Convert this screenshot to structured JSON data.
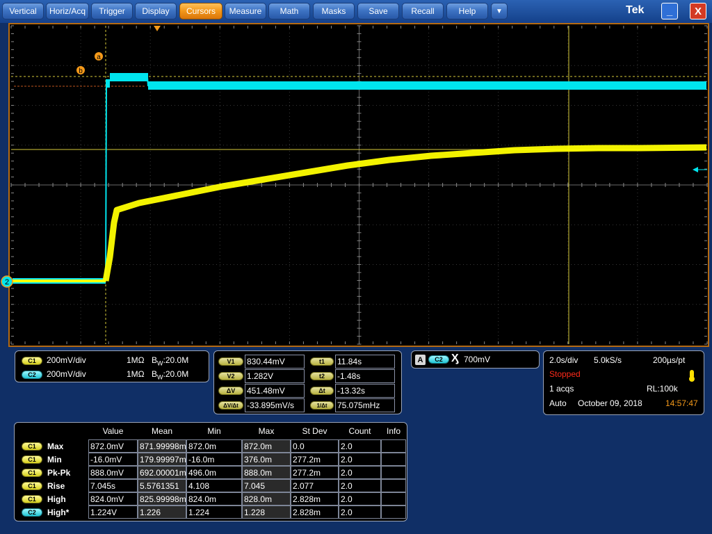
{
  "menu": {
    "items": [
      {
        "label": "Vertical"
      },
      {
        "label": "Horiz/Acq"
      },
      {
        "label": "Trigger"
      },
      {
        "label": "Display"
      },
      {
        "label": "Cursors",
        "active": true
      },
      {
        "label": "Measure"
      },
      {
        "label": "Math"
      },
      {
        "label": "Masks"
      },
      {
        "label": "Save"
      },
      {
        "label": "Recall"
      },
      {
        "label": "Help"
      }
    ],
    "dropdown_glyph": "▼",
    "brand": "Tek",
    "minimize_glyph": "_",
    "close_glyph": "X"
  },
  "graticule": {
    "cursor_a_label": "a",
    "cursor_b_label": "b",
    "channel2_marker": "2",
    "colors": {
      "ch1": "#ffff00",
      "ch2": "#00e5ee",
      "cursor": "#e0d050",
      "frame": "#b46a12",
      "marker": "#f59a1a"
    }
  },
  "channels": [
    {
      "name": "C1",
      "scale": "200mV/div",
      "impedance": "1MΩ",
      "bw_prefix": "B",
      "bw_sub": "W",
      "bw": ":20.0M"
    },
    {
      "name": "C2",
      "scale": "200mV/div",
      "impedance": "1MΩ",
      "bw_prefix": "B",
      "bw_sub": "W",
      "bw": ":20.0M"
    }
  ],
  "cursors": {
    "v1_label": "V1",
    "v1": "830.44mV",
    "v2_label": "V2",
    "v2": "1.282V",
    "dv_label": "ΔV",
    "dv": "451.48mV",
    "dvdt_label": "ΔV/Δt",
    "dvdt": "-33.895mV/s",
    "t1_label": "t1",
    "t1": "11.84s",
    "t2_label": "t2",
    "t2": "-1.48s",
    "dt_label": "Δt",
    "dt": "-13.32s",
    "inv_dt_label": "1/Δt",
    "inv_dt": "75.075mHz"
  },
  "trigger": {
    "mode_letter": "A",
    "source": "C2",
    "slope_glyph": "Ӽ",
    "level": "700mV"
  },
  "acquisition": {
    "time_div": "2.0s/div",
    "sample_rate": "5.0kS/s",
    "resolution": "200µs/pt",
    "state": "Stopped",
    "acqs": "1 acqs",
    "record_length": "RL:100k",
    "trigger_mode": "Auto",
    "date": "October 09, 2018",
    "time": "14:57:47"
  },
  "measurements": {
    "headers": [
      "Value",
      "Mean",
      "Min",
      "Max",
      "St Dev",
      "Count",
      "Info"
    ],
    "rows": [
      {
        "ch": "C1",
        "name": "Max",
        "cells": [
          "872.0mV",
          "871.99998m",
          "872.0m",
          "872.0m",
          "0.0",
          "2.0",
          ""
        ]
      },
      {
        "ch": "C1",
        "name": "Min",
        "cells": [
          "-16.0mV",
          "179.99997m",
          "-16.0m",
          "376.0m",
          "277.2m",
          "2.0",
          ""
        ]
      },
      {
        "ch": "C1",
        "name": "Pk-Pk",
        "cells": [
          "888.0mV",
          "692.00001m",
          "496.0m",
          "888.0m",
          "277.2m",
          "2.0",
          ""
        ]
      },
      {
        "ch": "C1",
        "name": "Rise",
        "cells": [
          "7.045s",
          "5.5761351",
          "4.108",
          "7.045",
          "2.077",
          "2.0",
          ""
        ]
      },
      {
        "ch": "C1",
        "name": "High",
        "cells": [
          "824.0mV",
          "825.99998m",
          "824.0m",
          "828.0m",
          "2.828m",
          "2.0",
          ""
        ]
      },
      {
        "ch": "C2",
        "name": "High*",
        "cells": [
          "1.224V",
          "1.226",
          "1.224",
          "1.228",
          "2.828m",
          "2.0",
          ""
        ]
      }
    ]
  }
}
